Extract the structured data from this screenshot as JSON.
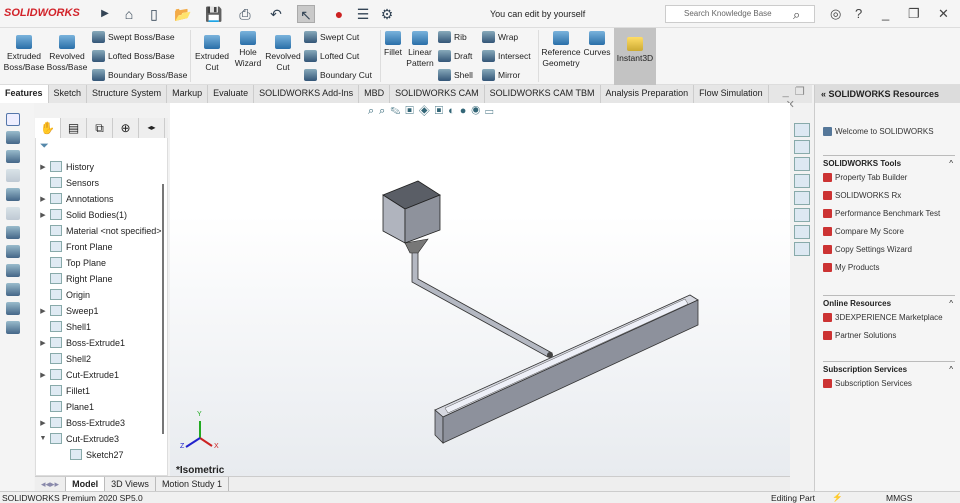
{
  "app": {
    "logo": "SOLIDWORKS",
    "title": "You can edit by yourself",
    "search_placeholder": "Search Knowledge Base"
  },
  "ribbon": {
    "big": [
      "Extruded Boss/Base",
      "Revolved Boss/Base",
      "Extruded Cut",
      "Hole Wizard",
      "Revolved Cut",
      "Fillet",
      "Linear Pattern",
      "Reference Geometry",
      "Curves",
      "Instant3D"
    ],
    "small": [
      "Swept Boss/Base",
      "Lofted Boss/Base",
      "Boundary Boss/Base",
      "Swept Cut",
      "Lofted Cut",
      "Boundary Cut",
      "Rib",
      "Draft",
      "Shell",
      "Wrap",
      "Intersect",
      "Mirror"
    ]
  },
  "tabs": [
    "Features",
    "Sketch",
    "Structure System",
    "Markup",
    "Evaluate",
    "SOLIDWORKS Add-Ins",
    "MBD",
    "SOLIDWORKS CAM",
    "SOLIDWORKS CAM TBM",
    "Analysis Preparation",
    "Flow Simulation"
  ],
  "tree": [
    "History",
    "Sensors",
    "Annotations",
    "Solid Bodies(1)",
    "Material <not specified>",
    "Front Plane",
    "Top Plane",
    "Right Plane",
    "Origin",
    "Sweep1",
    "Shell1",
    "Boss-Extrude1",
    "Shell2",
    "Cut-Extrude1",
    "Fillet1",
    "Plane1",
    "Boss-Extrude3",
    "Cut-Extrude3",
    "Sketch27"
  ],
  "viewport": {
    "view_label": "*Isometric",
    "axes": [
      "Y",
      "X",
      "Z"
    ]
  },
  "resources": {
    "title": "SOLIDWORKS Resources",
    "welcome": "Welcome to SOLIDWORKS",
    "sections": [
      {
        "title": "SOLIDWORKS Tools",
        "items": [
          "Property Tab Builder",
          "SOLIDWORKS Rx",
          "Performance Benchmark Test",
          "Compare My Score",
          "Copy Settings Wizard",
          "My Products"
        ]
      },
      {
        "title": "Online Resources",
        "items": [
          "3DEXPERIENCE Marketplace",
          "Partner Solutions"
        ]
      },
      {
        "title": "Subscription Services",
        "items": [
          "Subscription Services"
        ]
      }
    ]
  },
  "bottom_tabs": [
    "Model",
    "3D Views",
    "Motion Study 1"
  ],
  "status": {
    "left": "SOLIDWORKS Premium 2020 SP5.0",
    "mode": "Editing Part",
    "units": "MMGS"
  }
}
